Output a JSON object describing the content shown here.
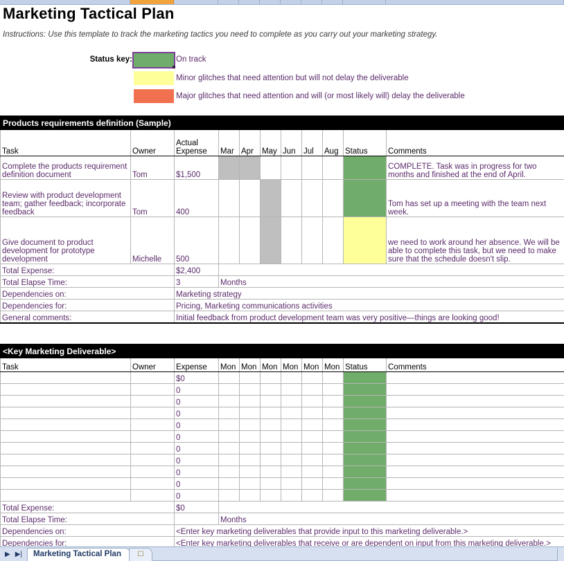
{
  "window": {
    "title": "Marketing Tactical Plan",
    "instructions": "Instructions: Use this template to track the marketing tactics you need to complete as you carry out your marketing strategy."
  },
  "colors": {
    "on_track": "#70AD6A",
    "minor_glitch": "#FFFF99",
    "major_glitch": "#F0704F",
    "gantt_fill": "#BFBFBF",
    "band_header_bg": "#000000",
    "selection_outline": "#7B3F98"
  },
  "status_key": {
    "label": "Status key:",
    "entries": [
      {
        "swatch": "on-track-swatch",
        "color": "#70AD6A",
        "text": "On track"
      },
      {
        "swatch": "minor-glitch-swatch",
        "color": "#FFFF99",
        "text": "Minor glitches that need attention but will not delay the deliverable"
      },
      {
        "swatch": "major-glitch-swatch",
        "color": "#F0704F",
        "text": "Major glitches that need attention and will (or most likely will) delay the deliverable"
      }
    ]
  },
  "section_one": {
    "band_title": "Products requirements definition (Sample)",
    "columns": {
      "task": "Task",
      "owner": "Owner",
      "expense_line1": "Actual",
      "expense_line2": "Expense",
      "months": [
        "Mar",
        "Apr",
        "May",
        "Jun",
        "Jul",
        "Aug"
      ],
      "status": "Status",
      "comments": "Comments"
    },
    "rows": [
      {
        "task": "Complete the products requirement definition document",
        "owner": "Tom",
        "expense": "$1,500",
        "months": [
          true,
          true,
          false,
          false,
          false,
          false
        ],
        "status_color": "#70AD6A",
        "status_name": "on-track",
        "comments": "COMPLETE. Task was in progress for two months and finished at the end of April."
      },
      {
        "task": "Review with product development team; gather feedback; incorporate feedback",
        "owner": "Tom",
        "expense": "400",
        "months": [
          false,
          false,
          true,
          false,
          false,
          false
        ],
        "status_color": "#70AD6A",
        "status_name": "on-track",
        "comments": "Tom has set up a meeting with the team next week."
      },
      {
        "task": "Give document to product development for prototype development",
        "owner": "Michelle",
        "expense": "500",
        "months": [
          false,
          false,
          true,
          false,
          false,
          false
        ],
        "status_color": "#FFFF99",
        "status_name": "minor-glitch",
        "comments": "we need to work around her absence. We will be able to complete this task, but we need to make sure that the schedule doesn't slip."
      }
    ],
    "summary": [
      {
        "label": "Total Expense:",
        "value": "$2,400",
        "unit": "",
        "numeric": true
      },
      {
        "label": "Total Elapse Time:",
        "value": "3",
        "unit": "Months",
        "numeric": false
      },
      {
        "label": "Dependencies on:",
        "value": "Marketing strategy",
        "unit": "",
        "numeric": false
      },
      {
        "label": "Dependencies for:",
        "value": "Pricing, Marketing communications activities",
        "unit": "",
        "numeric": false
      },
      {
        "label": "General comments:",
        "value": "Initial feedback from product development team was very positive—things are looking good!",
        "unit": "",
        "numeric": false
      }
    ]
  },
  "section_two": {
    "band_title": "<Key Marketing Deliverable>",
    "columns": {
      "task": "Task",
      "owner": "Owner",
      "expense": "Expense",
      "months": [
        "Mon",
        "Mon",
        "Mon",
        "Mon",
        "Mon",
        "Mon"
      ],
      "status": "Status",
      "comments": "Comments"
    },
    "rows": [
      {
        "task": "",
        "owner": "",
        "expense": "$0",
        "status_color": "#70AD6A",
        "comments": ""
      },
      {
        "task": "",
        "owner": "",
        "expense": "0",
        "status_color": "#70AD6A",
        "comments": ""
      },
      {
        "task": "",
        "owner": "",
        "expense": "0",
        "status_color": "#70AD6A",
        "comments": ""
      },
      {
        "task": "",
        "owner": "",
        "expense": "0",
        "status_color": "#70AD6A",
        "comments": ""
      },
      {
        "task": "",
        "owner": "",
        "expense": "0",
        "status_color": "#70AD6A",
        "comments": ""
      },
      {
        "task": "",
        "owner": "",
        "expense": "0",
        "status_color": "#70AD6A",
        "comments": ""
      },
      {
        "task": "",
        "owner": "",
        "expense": "0",
        "status_color": "#70AD6A",
        "comments": ""
      },
      {
        "task": "",
        "owner": "",
        "expense": "0",
        "status_color": "#70AD6A",
        "comments": ""
      },
      {
        "task": "",
        "owner": "",
        "expense": "0",
        "status_color": "#70AD6A",
        "comments": ""
      },
      {
        "task": "",
        "owner": "",
        "expense": "0",
        "status_color": "#70AD6A",
        "comments": ""
      },
      {
        "task": "",
        "owner": "",
        "expense": "0",
        "status_color": "#70AD6A",
        "comments": ""
      }
    ],
    "summary": [
      {
        "label": "Total Expense:",
        "value": "$0",
        "unit": "",
        "numeric": true
      },
      {
        "label": "Total Elapse Time:",
        "value": "",
        "unit": "Months",
        "numeric": false
      },
      {
        "label": "Dependencies on:",
        "value": "<Enter key marketing deliverables that provide input to this marketing deliverable.>",
        "unit": "",
        "numeric": false
      },
      {
        "label": "Dependencies for:",
        "value": "<Enter key marketing deliverables that receive or are dependent on input from this marketing deliverable.>",
        "unit": "",
        "numeric": false
      }
    ]
  },
  "tabbar": {
    "nav_prev": "▶",
    "nav_last": "▶|",
    "active_tab": "Marketing Tactical Plan",
    "insert_tab_icon": "insert-worksheet-icon"
  }
}
